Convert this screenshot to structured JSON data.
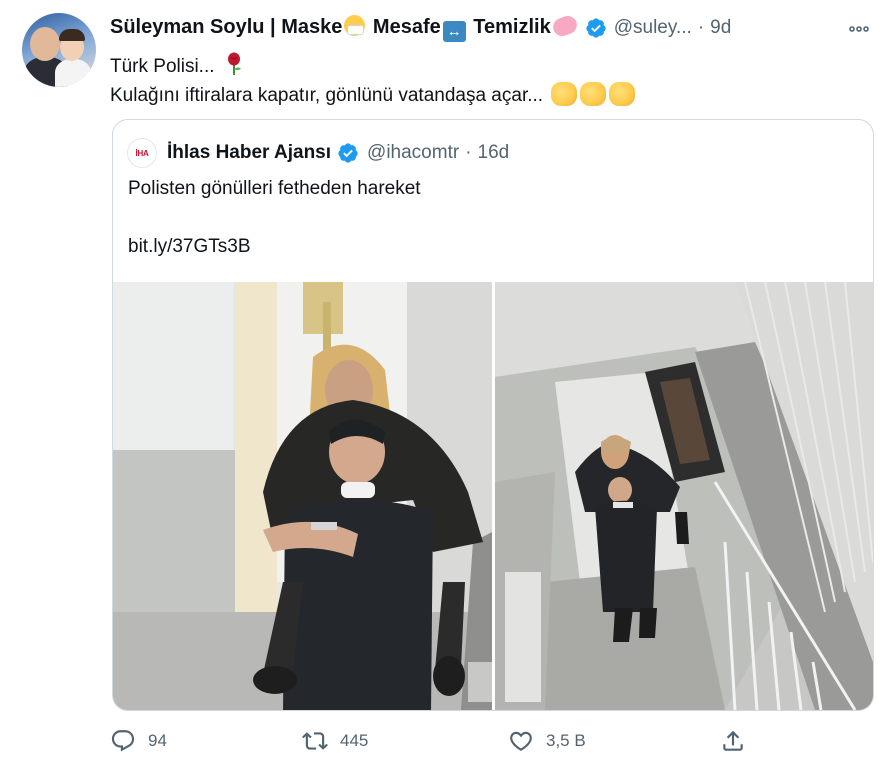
{
  "author": {
    "name_parts": [
      "Süleyman Soylu | Maske",
      " Mesafe",
      " Temizlik"
    ],
    "handle": "@suley...",
    "time": "9d",
    "verified": true
  },
  "tweet": {
    "line1": "Türk Polisi...",
    "line2": "Kulağını iftiralara kapatır, gönlünü vatandaşa açar..."
  },
  "quoted": {
    "name": "İhlas Haber Ajansı",
    "handle": "@ihacomtr",
    "time": "16d",
    "avatar_text": "İHA",
    "text": "Polisten gönülleri fetheden hareket",
    "link": "bit.ly/37GTs3B",
    "dot": "·"
  },
  "actions": {
    "replies": "94",
    "retweets": "445",
    "likes": "3,5 B"
  },
  "colors": {
    "verified": "#1d9bf0",
    "muted": "#536471",
    "border": "#cfd9de"
  },
  "icons": [
    "more-icon",
    "verified-icon",
    "reply-icon",
    "retweet-icon",
    "like-icon",
    "share-icon"
  ]
}
